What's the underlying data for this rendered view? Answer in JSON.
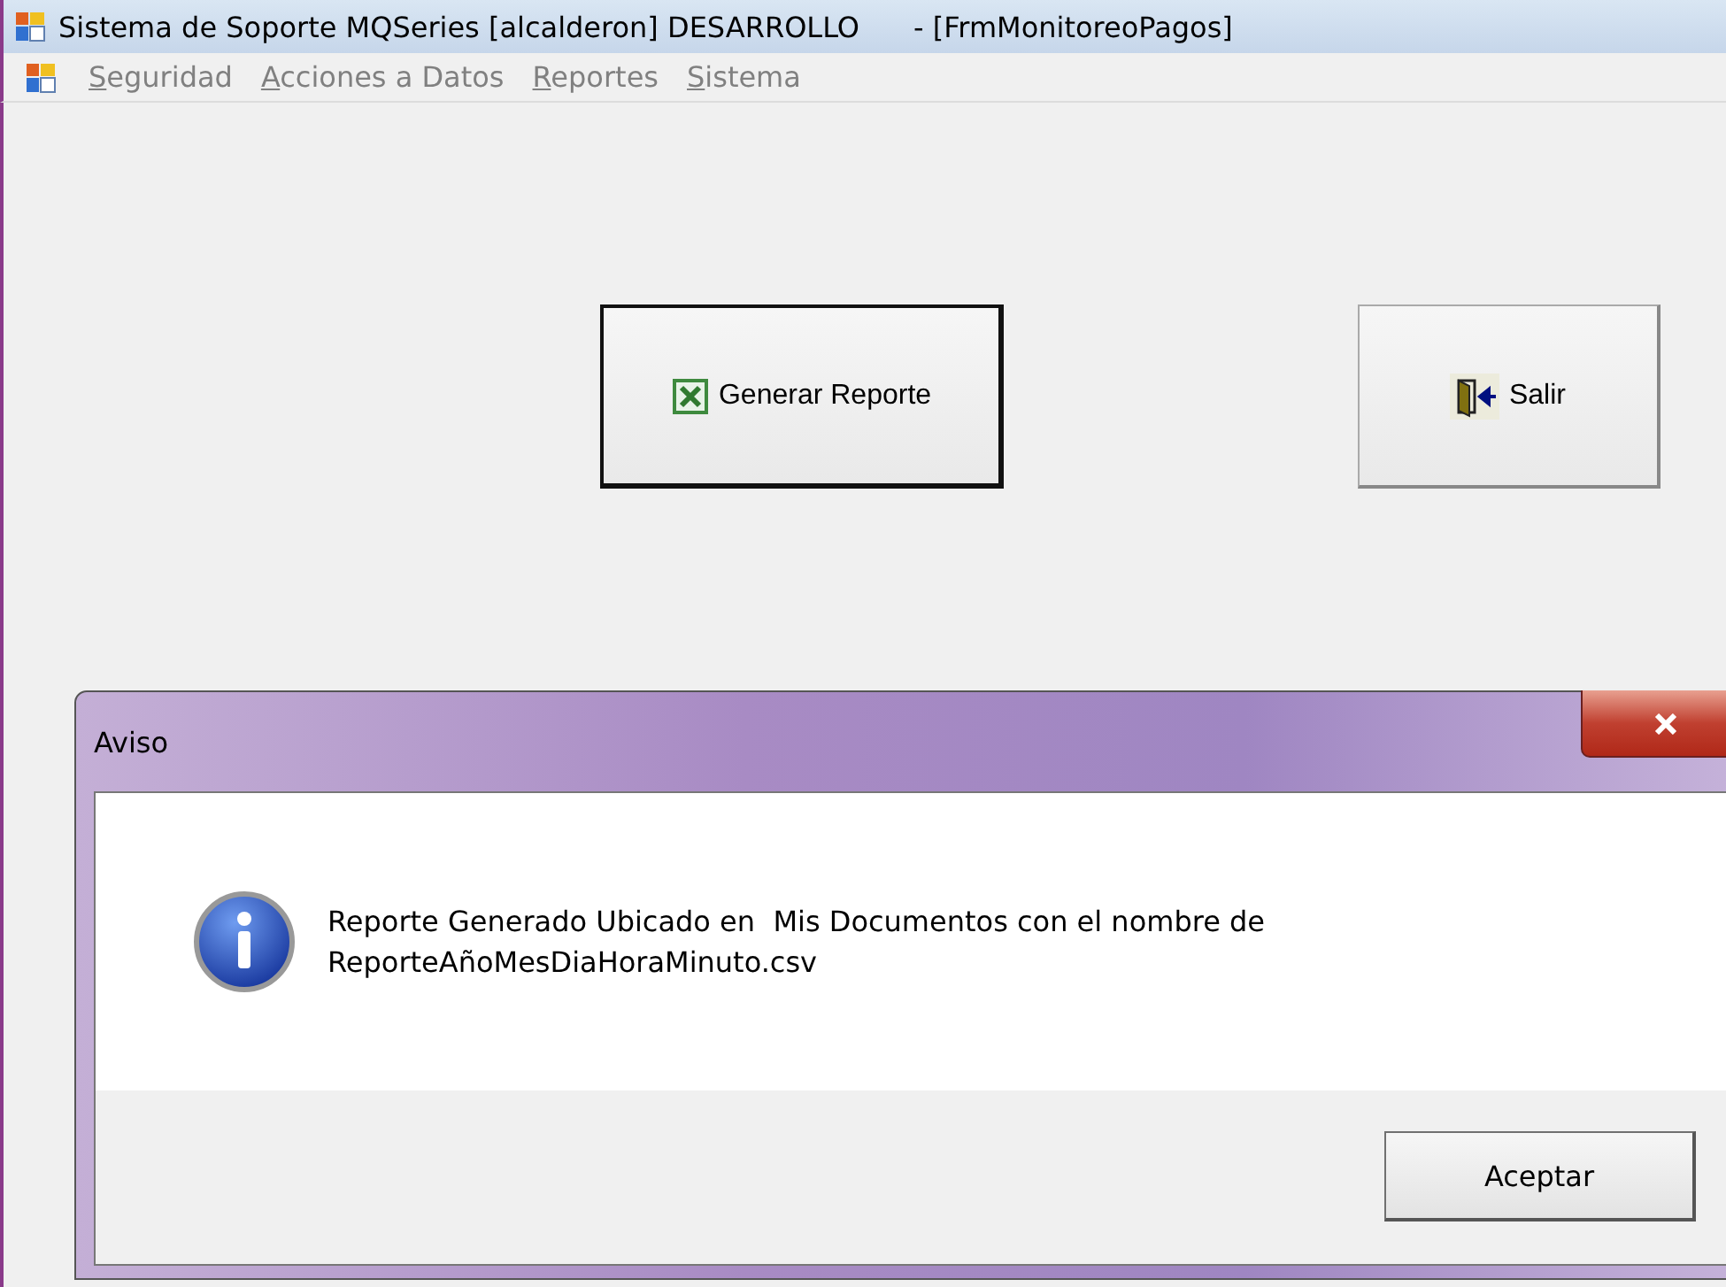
{
  "window": {
    "title": "Sistema de Soporte MQSeries [alcalderon] DESARROLLO      - [FrmMonitoreoPagos]"
  },
  "menu": [
    {
      "label": "Seguridad",
      "underline_first": true
    },
    {
      "label": "Acciones a Datos",
      "underline_first": true
    },
    {
      "label": "Reportes",
      "underline_first": true
    },
    {
      "label": "Sistema",
      "underline_first": true
    }
  ],
  "buttons": [
    {
      "label": "Generar Reporte",
      "kind": "excel",
      "focused": true
    },
    {
      "label": "Salir",
      "kind": "exit",
      "focused": false
    }
  ],
  "dialog": {
    "title": "Aviso",
    "message": "Reporte Generado Ubicado en  Mis Documentos con el nombre de\nReporteAñoMesDiaHoraMinuto.csv",
    "button": "Aceptar"
  }
}
